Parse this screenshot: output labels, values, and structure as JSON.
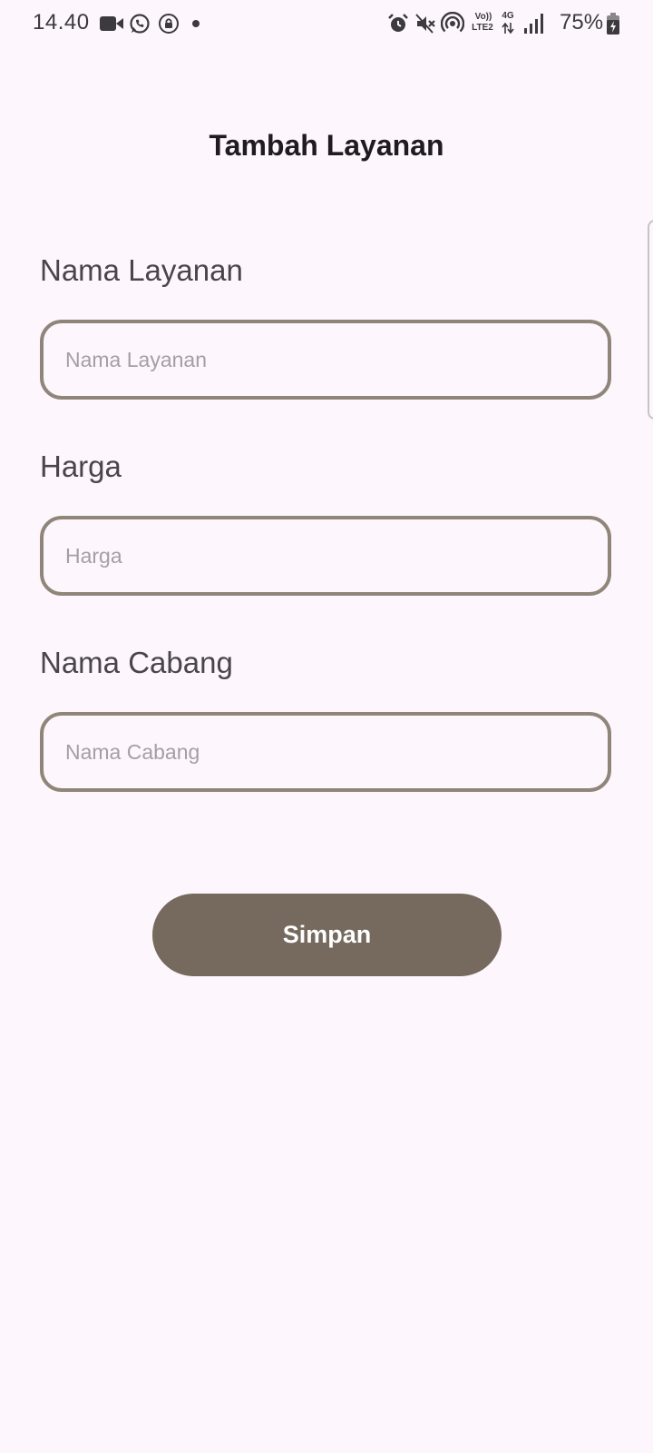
{
  "status_bar": {
    "time": "14.40",
    "battery_percent": "75%",
    "volte_label_top": "Vo))",
    "volte_label_bottom": "LTE2",
    "network_label": "4G",
    "icons": [
      "video-camera-icon",
      "whatsapp-icon",
      "lock-icon",
      "dot-icon",
      "alarm-icon",
      "mute-icon",
      "hotspot-icon",
      "volte-icon",
      "network-4g-icon",
      "signal-icon",
      "battery-icon"
    ]
  },
  "page": {
    "title": "Tambah Layanan"
  },
  "form": {
    "fields": [
      {
        "label": "Nama Layanan",
        "placeholder": "Nama Layanan",
        "value": ""
      },
      {
        "label": "Harga",
        "placeholder": "Harga",
        "value": ""
      },
      {
        "label": "Nama Cabang",
        "placeholder": "Nama Cabang",
        "value": ""
      }
    ],
    "submit_label": "Simpan"
  },
  "colors": {
    "background": "#fdf7fd",
    "field_border": "#8f8579",
    "button_bg": "#766a5e",
    "button_text": "#ffffff"
  }
}
